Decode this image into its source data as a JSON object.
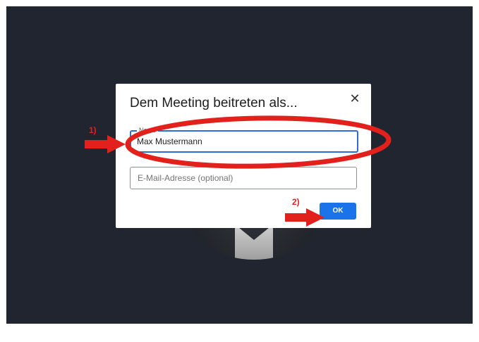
{
  "dialog": {
    "title": "Dem Meeting beitreten als...",
    "close_icon": "close-icon",
    "name_field": {
      "label": "Name",
      "value": "Max Mustermann"
    },
    "email_field": {
      "placeholder": "E-Mail-Adresse (optional)"
    },
    "ok_label": "OK"
  },
  "annotations": {
    "step1_label": "1)",
    "step2_label": "2)",
    "color": "#e3211c"
  },
  "colors": {
    "background": "#202530",
    "accent": "#1a73e8"
  }
}
